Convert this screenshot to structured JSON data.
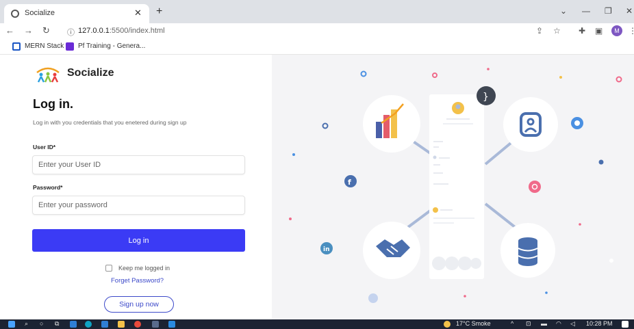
{
  "browser": {
    "tab_title": "Socialize",
    "url_host": "127.0.0.1",
    "url_path": ":5500/index.html",
    "profile_initial": "M",
    "bookmarks": [
      {
        "label": "MERN Stack"
      },
      {
        "label": "Pf Training - Genera..."
      }
    ]
  },
  "login": {
    "brand": "Socialize",
    "title": "Log in.",
    "description": "Log in with you credentials that you enetered during sign up",
    "userid_label": "User ID*",
    "userid_placeholder": "Enter your User ID",
    "password_label": "Password*",
    "password_placeholder": "Enter your password",
    "submit_label": "Log in",
    "keep_logged_in": "Keep me logged in",
    "forgot_password": "Forget Password?",
    "signup_label": "Sign up now"
  },
  "taskbar": {
    "weather": "17°C  Smoke",
    "time": "10:28 PM"
  },
  "colors": {
    "primary": "#3b3bf5",
    "link": "#3b48c9",
    "illustration_bg": "#f4f4f6",
    "connector": "#a9b9d8"
  },
  "icons": [
    "facebook-icon",
    "twitter-icon",
    "instagram-icon",
    "linkedin-icon",
    "bar-chart-icon",
    "user-badge-icon",
    "handshake-icon",
    "database-icon",
    "code-icon"
  ]
}
